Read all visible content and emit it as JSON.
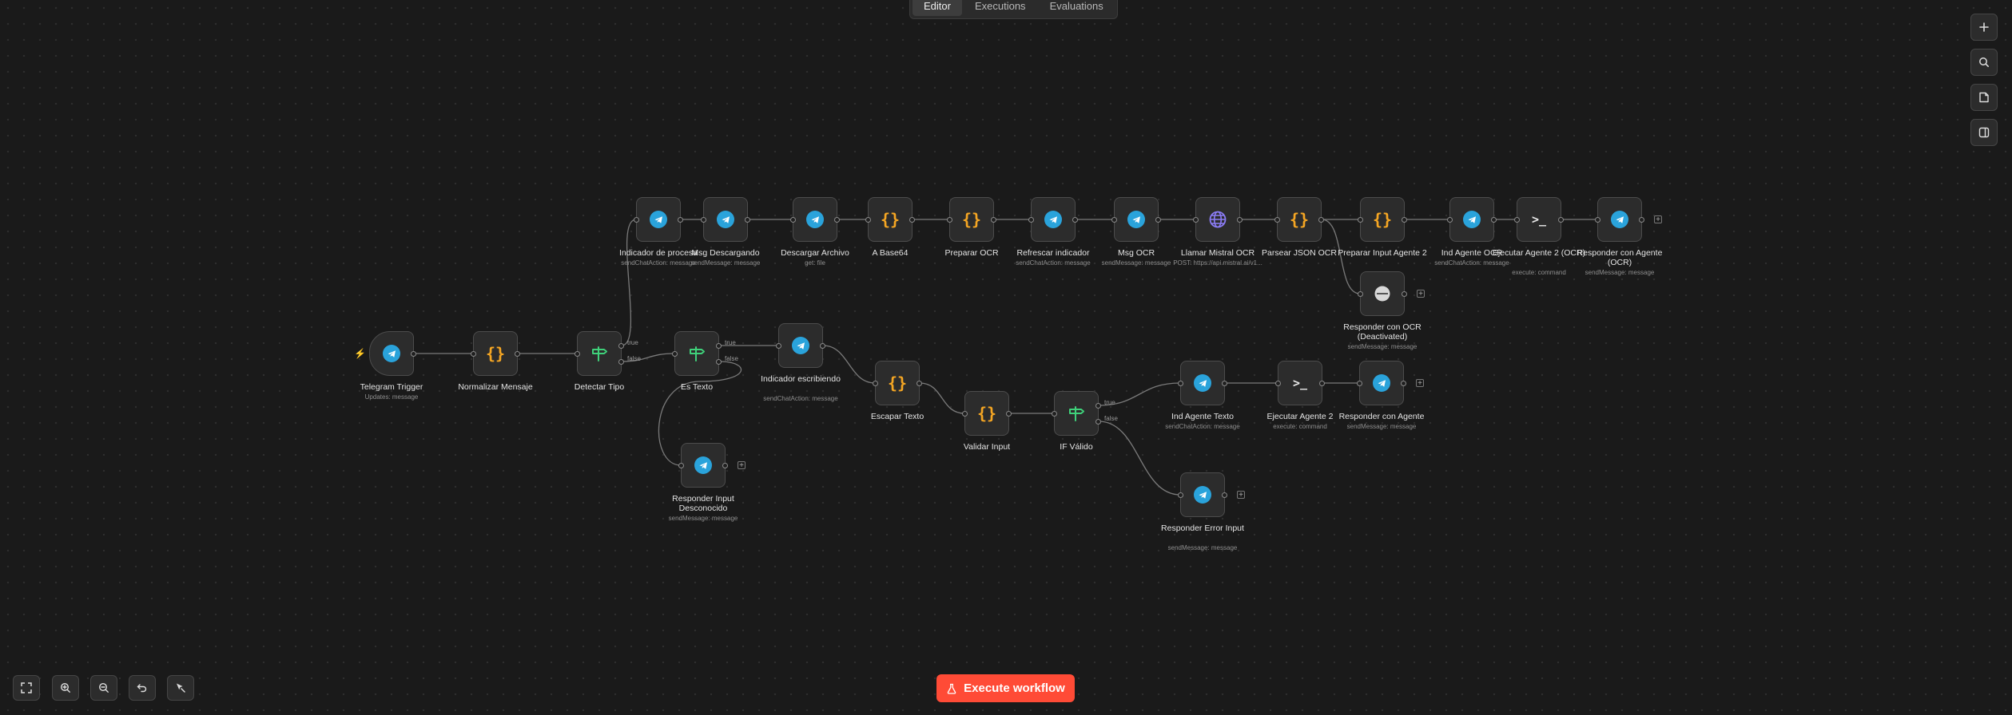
{
  "tabs": [
    "Editor",
    "Executions",
    "Evaluations"
  ],
  "active_tab": "Editor",
  "right_toolbar": [
    "plus-icon",
    "search-icon",
    "sticky-note-icon",
    "panel-toggle-icon"
  ],
  "bottom_toolbar": [
    "fit-view-icon",
    "zoom-in-icon",
    "zoom-out-icon",
    "undo-icon",
    "tidy-up-icon"
  ],
  "execute_button": "Execute workflow",
  "accent_color": "#ff4b36",
  "branch_labels": {
    "true": "true",
    "false": "false"
  },
  "nodes": [
    {
      "id": "ind-proc",
      "title": "Indicador de procesa",
      "subtitle": "sendChatAction: message",
      "icon": "telegram"
    },
    {
      "id": "msg-desc",
      "title": "Msg Descargando",
      "subtitle": "sendMessage: message",
      "icon": "telegram"
    },
    {
      "id": "desc-arch",
      "title": "Descargar Archivo",
      "subtitle": "get: file",
      "icon": "telegram"
    },
    {
      "id": "a-b64",
      "title": "A Base64",
      "subtitle": "",
      "icon": "code"
    },
    {
      "id": "prep-ocr",
      "title": "Preparar OCR",
      "subtitle": "",
      "icon": "code"
    },
    {
      "id": "refr",
      "title": "Refrescar indicador",
      "subtitle": "sendChatAction: message",
      "icon": "telegram"
    },
    {
      "id": "msg-ocr",
      "title": "Msg OCR",
      "subtitle": "sendMessage: message",
      "icon": "telegram"
    },
    {
      "id": "llamar",
      "title": "Llamar Mistral OCR",
      "subtitle": "POST: https://api.mistral.ai/v1...",
      "icon": "globe"
    },
    {
      "id": "parsear",
      "title": "Parsear JSON OCR",
      "subtitle": "",
      "icon": "code"
    },
    {
      "id": "prep-a2",
      "title": "Preparar Input Agente 2",
      "subtitle": "",
      "icon": "code"
    },
    {
      "id": "ind-ocr",
      "title": "Ind Agente OCR",
      "subtitle": "sendChatAction: message",
      "icon": "telegram"
    },
    {
      "id": "ejec-ocr",
      "title": "Ejecutar Agente 2 (OCR)",
      "subtitle": "execute: command",
      "icon": "terminal"
    },
    {
      "id": "resp-ocr",
      "title": "Responder con Agente (OCR)",
      "subtitle": "sendMessage: message",
      "icon": "telegram"
    },
    {
      "id": "resp-ocr-deact",
      "title": "Responder con OCR (Deactivated)",
      "subtitle": "sendMessage: message",
      "icon": "deactivated"
    },
    {
      "id": "trigger",
      "title": "Telegram Trigger",
      "subtitle": "Updates: message",
      "icon": "telegram"
    },
    {
      "id": "normalizar",
      "title": "Normalizar Mensaje",
      "subtitle": "",
      "icon": "code"
    },
    {
      "id": "detectar",
      "title": "Detectar Tipo",
      "subtitle": "",
      "icon": "if"
    },
    {
      "id": "es-texto",
      "title": "Es Texto",
      "subtitle": "",
      "icon": "if"
    },
    {
      "id": "ind-escr",
      "title": "Indicador escribiendo",
      "subtitle": "sendChatAction: message",
      "icon": "telegram"
    },
    {
      "id": "escapar",
      "title": "Escapar Texto",
      "subtitle": "",
      "icon": "code"
    },
    {
      "id": "validar",
      "title": "Validar Input",
      "subtitle": "",
      "icon": "code"
    },
    {
      "id": "if-valido",
      "title": "IF Válido",
      "subtitle": "",
      "icon": "if"
    },
    {
      "id": "ind-texto",
      "title": "Ind Agente Texto",
      "subtitle": "sendChatAction: message",
      "icon": "telegram"
    },
    {
      "id": "ejec-a2",
      "title": "Ejecutar Agente 2",
      "subtitle": "execute: command",
      "icon": "terminal"
    },
    {
      "id": "resp-agente",
      "title": "Responder con Agente",
      "subtitle": "sendMessage: message",
      "icon": "telegram"
    },
    {
      "id": "resp-error",
      "title": "Responder Error Input",
      "subtitle": "sendMessage: message",
      "icon": "telegram"
    },
    {
      "id": "resp-desc",
      "title": "Responder Input Desconocido",
      "subtitle": "sendMessage: message",
      "icon": "telegram"
    }
  ],
  "connections": [
    [
      "trigger",
      "normalizar"
    ],
    [
      "normalizar",
      "detectar"
    ],
    [
      "detectar",
      "ind-proc",
      "true"
    ],
    [
      "detectar",
      "es-texto",
      "false"
    ],
    [
      "ind-proc",
      "msg-desc"
    ],
    [
      "msg-desc",
      "desc-arch"
    ],
    [
      "desc-arch",
      "a-b64"
    ],
    [
      "a-b64",
      "prep-ocr"
    ],
    [
      "prep-ocr",
      "refr"
    ],
    [
      "refr",
      "msg-ocr"
    ],
    [
      "msg-ocr",
      "llamar"
    ],
    [
      "llamar",
      "parsear"
    ],
    [
      "parsear",
      "prep-a2"
    ],
    [
      "parsear",
      "resp-ocr-deact"
    ],
    [
      "prep-a2",
      "ind-ocr"
    ],
    [
      "ind-ocr",
      "ejec-ocr"
    ],
    [
      "ejec-ocr",
      "resp-ocr"
    ],
    [
      "es-texto",
      "ind-escr",
      "true"
    ],
    [
      "es-texto",
      "resp-desc",
      "false"
    ],
    [
      "ind-escr",
      "escapar"
    ],
    [
      "escapar",
      "validar"
    ],
    [
      "validar",
      "if-valido"
    ],
    [
      "if-valido",
      "ind-texto",
      "true"
    ],
    [
      "if-valido",
      "resp-error",
      "false"
    ],
    [
      "ind-texto",
      "ejec-a2"
    ],
    [
      "ejec-a2",
      "resp-agente"
    ]
  ]
}
